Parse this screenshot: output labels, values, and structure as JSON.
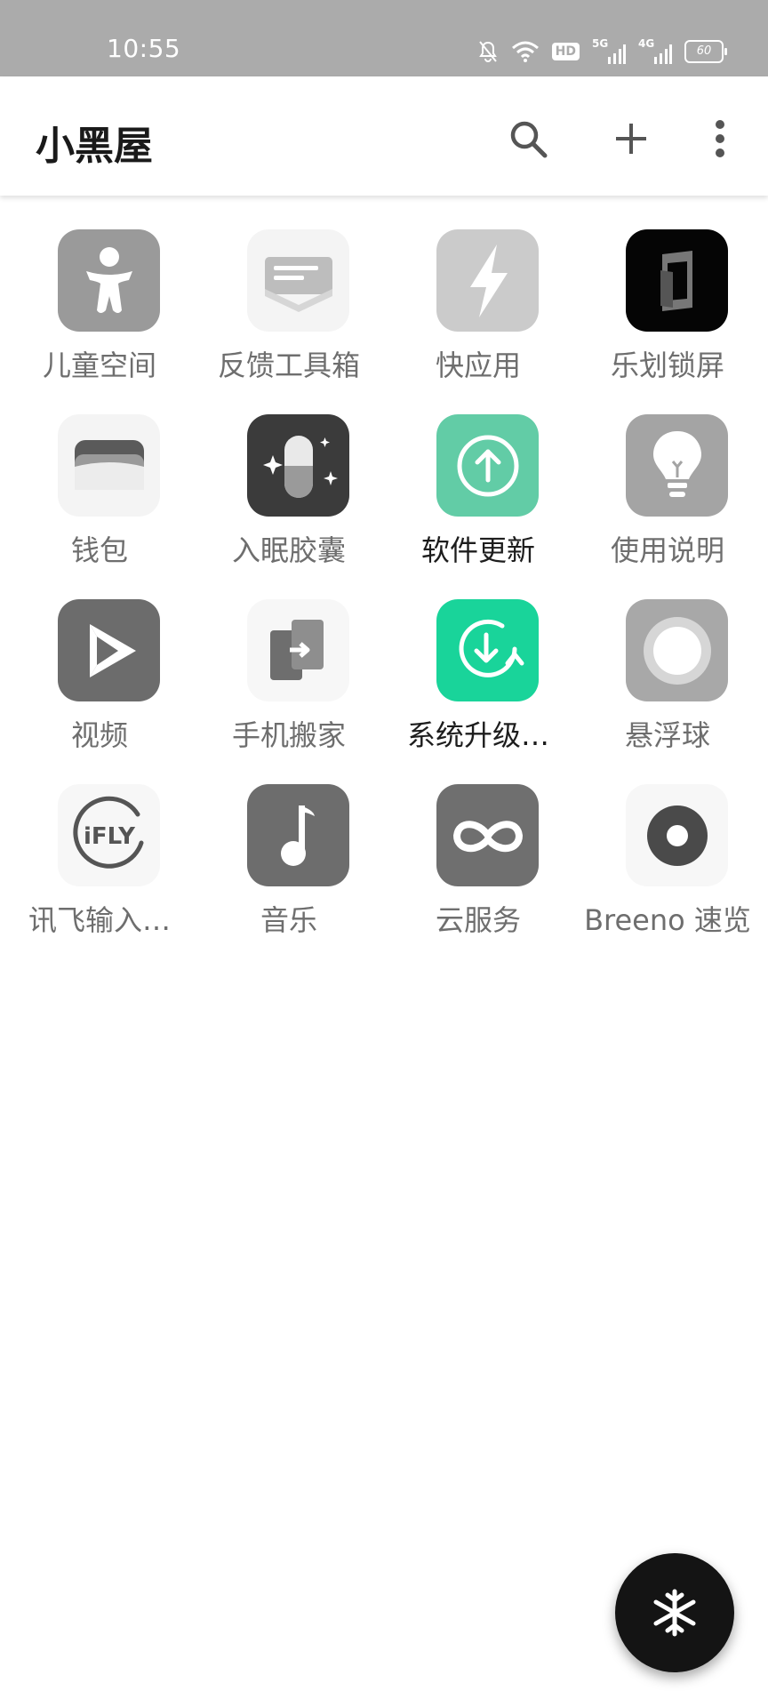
{
  "status_bar": {
    "time": "10:55",
    "hd_label": "HD",
    "net1_label": "5G",
    "net2_label": "4G",
    "battery_level": "60",
    "icons": [
      "mute-bell-icon",
      "wifi-icon",
      "hd-icon",
      "5g-signal-icon",
      "4g-signal-icon",
      "battery-icon"
    ]
  },
  "header": {
    "title": "小黑屋",
    "actions": [
      "search-icon",
      "add-icon",
      "more-icon"
    ]
  },
  "apps": [
    {
      "label": "儿童空间",
      "icon": "kid-icon",
      "color": "#9a9a9a"
    },
    {
      "label": "反馈工具箱",
      "icon": "feedback-icon",
      "color": "#f4f4f4"
    },
    {
      "label": "快应用",
      "icon": "lightning-icon",
      "color": "#cbcbcb"
    },
    {
      "label": "乐划锁屏",
      "icon": "lockscreen-icon",
      "color": "#050505"
    },
    {
      "label": "钱包",
      "icon": "wallet-icon",
      "color": "#f4f4f4"
    },
    {
      "label": "入眠胶囊",
      "icon": "capsule-icon",
      "color": "#3b3b3b"
    },
    {
      "label": "软件更新",
      "icon": "upload-icon",
      "color": "#62cca6"
    },
    {
      "label": "使用说明",
      "icon": "bulb-icon",
      "color": "#a4a4a4"
    },
    {
      "label": "视频",
      "icon": "play-icon",
      "color": "#6c6c6c"
    },
    {
      "label": "手机搬家",
      "icon": "phone-move-icon",
      "color": "#f7f7f7"
    },
    {
      "label": "系统升级…",
      "icon": "system-update-icon",
      "color": "#19d49a"
    },
    {
      "label": "悬浮球",
      "icon": "float-ball-icon",
      "color": "#a8a8a8"
    },
    {
      "label": "讯飞输入…",
      "icon": "ifly-icon",
      "color": "#f7f7f7"
    },
    {
      "label": "音乐",
      "icon": "music-note-icon",
      "color": "#6d6d6d"
    },
    {
      "label": "云服务",
      "icon": "cloud-infinity-icon",
      "color": "#6f6f6f"
    },
    {
      "label": "Breeno 速览",
      "icon": "breeno-icon",
      "color": "#f7f7f7"
    }
  ],
  "ifly_text": "iFLY",
  "fab": {
    "icon": "snowflake-icon"
  }
}
